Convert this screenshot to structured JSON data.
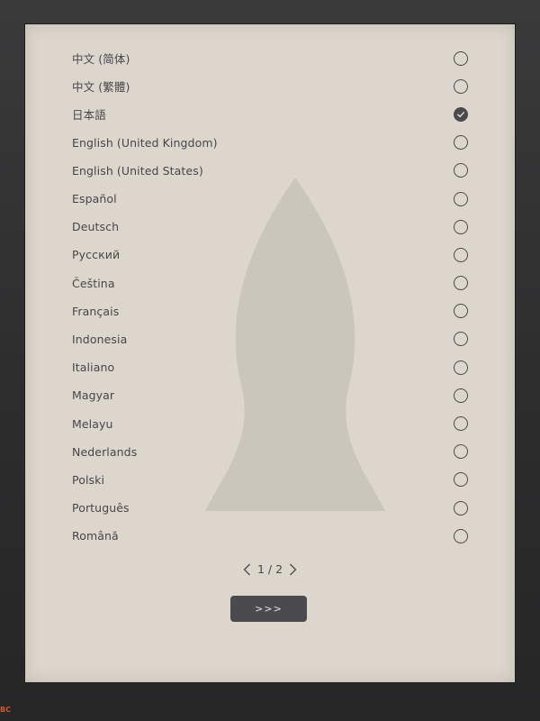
{
  "languages": [
    {
      "label": "中文 (简体)",
      "selected": false
    },
    {
      "label": "中文 (繁體)",
      "selected": false
    },
    {
      "label": "日本語",
      "selected": true
    },
    {
      "label": "English (United Kingdom)",
      "selected": false
    },
    {
      "label": "English (United States)",
      "selected": false
    },
    {
      "label": "Español",
      "selected": false
    },
    {
      "label": "Deutsch",
      "selected": false
    },
    {
      "label": "Русский",
      "selected": false
    },
    {
      "label": "Čeština",
      "selected": false
    },
    {
      "label": "Français",
      "selected": false
    },
    {
      "label": "Indonesia",
      "selected": false
    },
    {
      "label": "Italiano",
      "selected": false
    },
    {
      "label": "Magyar",
      "selected": false
    },
    {
      "label": "Melayu",
      "selected": false
    },
    {
      "label": "Nederlands",
      "selected": false
    },
    {
      "label": "Polski",
      "selected": false
    },
    {
      "label": "Português",
      "selected": false
    },
    {
      "label": "Română",
      "selected": false
    }
  ],
  "pager": {
    "text": "1 / 2",
    "prev_icon": "chevron-left-icon",
    "next_icon": "chevron-right-icon"
  },
  "next_button": {
    "label": ">>>"
  },
  "brand": {
    "text": "BC"
  },
  "colors": {
    "screen_bg": "#dcd6cc",
    "text": "#46464a",
    "button_bg": "#4b4b4f",
    "bezel": "#2f2f30"
  }
}
